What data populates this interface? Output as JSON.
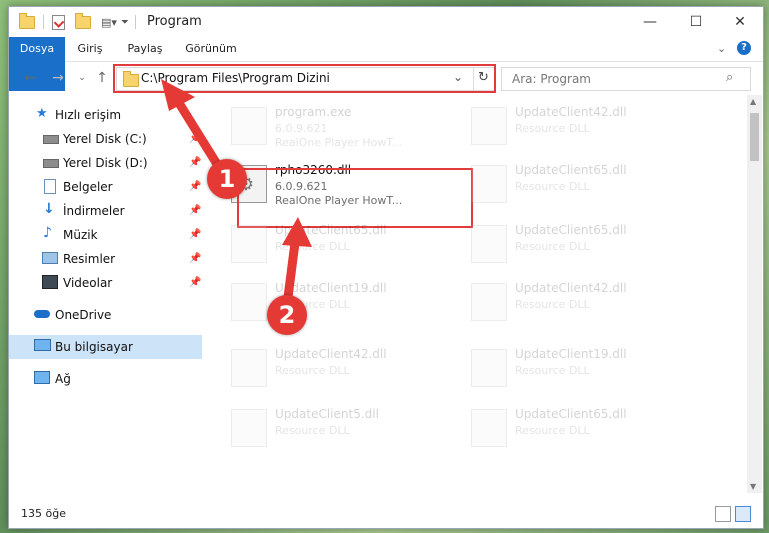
{
  "window": {
    "title": "Program",
    "controls": {
      "minimize": "—",
      "maximize": "☐",
      "close": "✕"
    }
  },
  "ribbon": {
    "tabs": [
      "Dosya",
      "Giriş",
      "Paylaş",
      "Görünüm"
    ]
  },
  "address": {
    "path": "C:\\Program Files\\Program Dizini",
    "search_placeholder": "Ara: Program"
  },
  "sidebar": {
    "items": [
      {
        "label": "Hızlı erişim",
        "icon": "star-icon",
        "pinned": false
      },
      {
        "label": "Yerel Disk (C:)",
        "icon": "drive-icon",
        "pinned": true
      },
      {
        "label": "Yerel Disk (D:)",
        "icon": "drive-icon",
        "pinned": true
      },
      {
        "label": "Belgeler",
        "icon": "documents-icon",
        "pinned": true
      },
      {
        "label": "İndirmeler",
        "icon": "download-icon",
        "pinned": true
      },
      {
        "label": "Müzik",
        "icon": "music-icon",
        "pinned": true
      },
      {
        "label": "Resimler",
        "icon": "pictures-icon",
        "pinned": true
      },
      {
        "label": "Videolar",
        "icon": "video-icon",
        "pinned": true
      },
      {
        "label": "OneDrive",
        "icon": "cloud-icon",
        "pinned": false
      },
      {
        "label": "Bu bilgisayar",
        "icon": "computer-icon",
        "pinned": false,
        "selected": true
      },
      {
        "label": "Ağ",
        "icon": "network-icon",
        "pinned": false
      }
    ]
  },
  "files": [
    {
      "name": "program.exe",
      "version": "6.0.9.621",
      "desc": "RealOne Player HowT...",
      "faded": true
    },
    {
      "name": "UpdateClient42.dll",
      "version": "Resource DLL",
      "desc": "",
      "faded": true
    },
    {
      "name": "rpho3260.dll",
      "version": "6.0.9.621",
      "desc": "RealOne Player HowT...",
      "faded": false
    },
    {
      "name": "UpdateClient65.dll",
      "version": "Resource DLL",
      "desc": "",
      "faded": true
    },
    {
      "name": "UpdateClient65.dll",
      "version": "Resource DLL",
      "desc": "",
      "faded": true
    },
    {
      "name": "UpdateClient65.dll",
      "version": "Resource DLL",
      "desc": "",
      "faded": true
    },
    {
      "name": "UpdateClient19.dll",
      "version": "Resource DLL",
      "desc": "",
      "faded": true
    },
    {
      "name": "UpdateClient42.dll",
      "version": "Resource DLL",
      "desc": "",
      "faded": true
    },
    {
      "name": "UpdateClient42.dll",
      "version": "Resource DLL",
      "desc": "",
      "faded": true
    },
    {
      "name": "UpdateClient19.dll",
      "version": "Resource DLL",
      "desc": "",
      "faded": true
    },
    {
      "name": "UpdateClient5.dll",
      "version": "Resource DLL",
      "desc": "",
      "faded": true
    },
    {
      "name": "UpdateClient65.dll",
      "version": "Resource DLL",
      "desc": "",
      "faded": true
    }
  ],
  "status": {
    "item_count": "135 öğe"
  },
  "callouts": [
    "1",
    "2"
  ],
  "colors": {
    "accent": "#1a6fc9",
    "highlight_box": "#e23b3b",
    "callout": "#e53935"
  }
}
